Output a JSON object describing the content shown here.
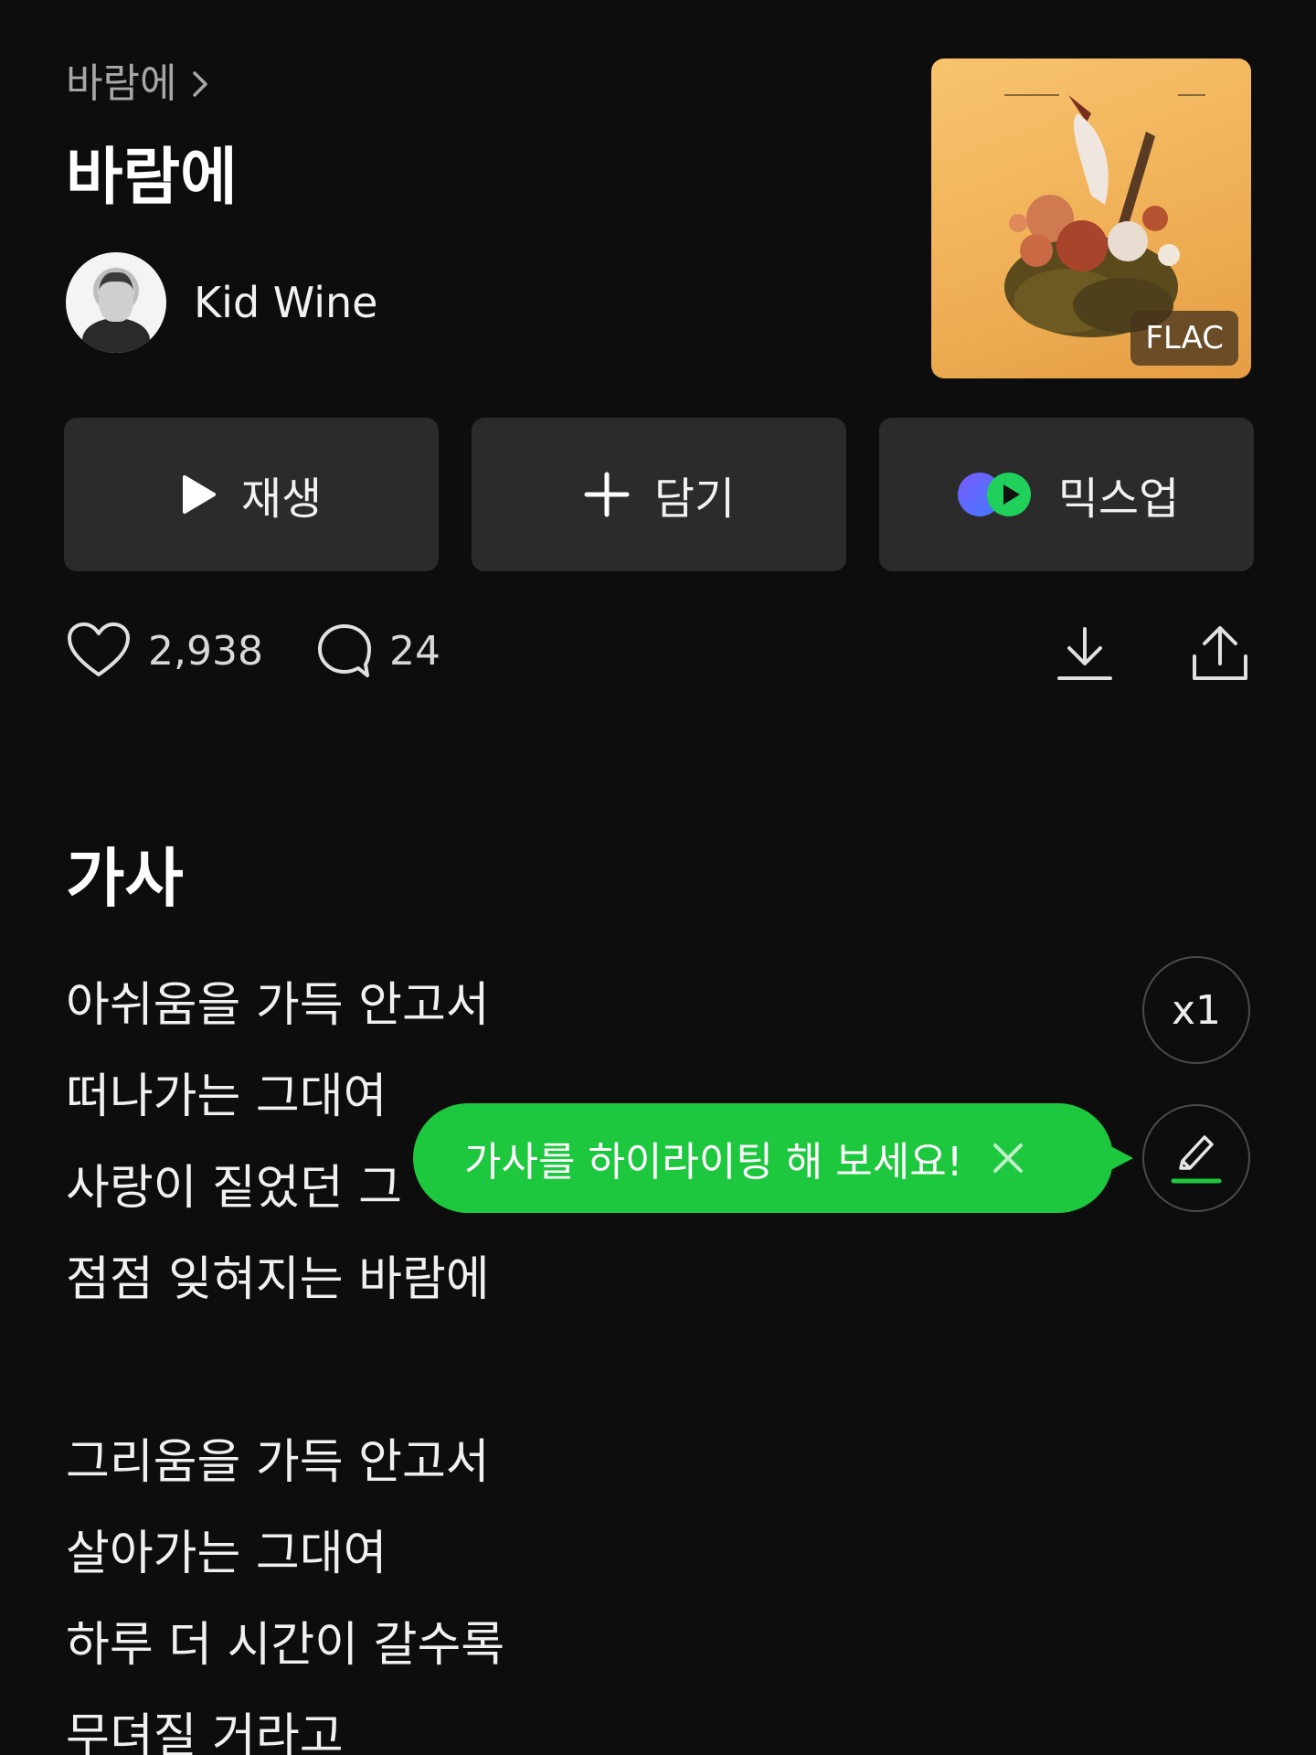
{
  "header": {
    "breadcrumb": "바람에",
    "title": "바람에",
    "artist": "Kid Wine"
  },
  "album": {
    "badge": "FLAC"
  },
  "actions": {
    "play_label": "재생",
    "add_label": "담기",
    "mixup_label": "믹스업"
  },
  "stats": {
    "likes": "2,938",
    "comments": "24"
  },
  "lyrics": {
    "title": "가사",
    "speed": "x1",
    "tooltip": "가사를 하이라이팅 해 보세요!",
    "lines": [
      "아쉬움을 가득 안고서",
      "떠나가는 그대여",
      "사랑이 짙었던 그",
      "점점 잊혀지는 바람에",
      "",
      "그리움을 가득 안고서",
      "살아가는 그대여",
      "하루 더 시간이 갈수록",
      "무뎌질 거라고"
    ]
  },
  "colors": {
    "background": "#0d0d0d",
    "button": "#2b2b2b",
    "accent_green": "#1dc83e"
  }
}
